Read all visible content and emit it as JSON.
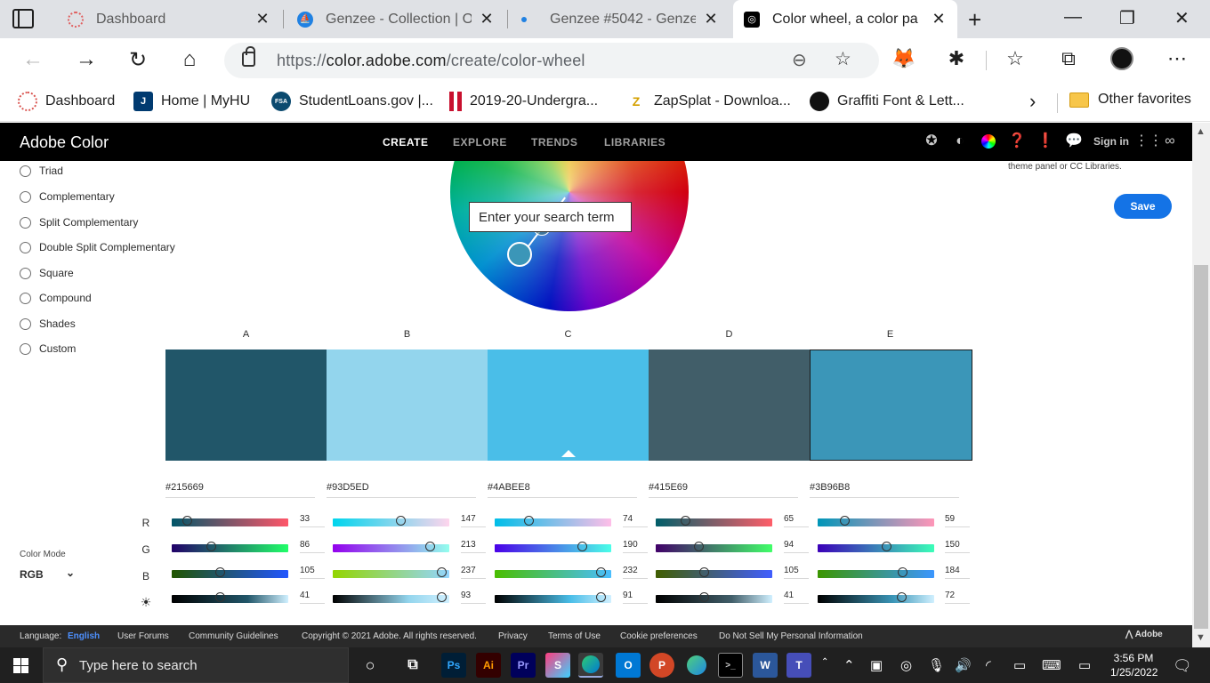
{
  "browser": {
    "tabs": [
      {
        "title": "Dashboard",
        "favicon_color": "#e06060"
      },
      {
        "title": "Genzee - Collection | O",
        "favicon_color": "#2081e2"
      },
      {
        "title": "Genzee #5042 - Genze",
        "favicon_color": "#2081e2"
      },
      {
        "title": "Color wheel, a color pa",
        "favicon_color": "#000000"
      }
    ],
    "close_glyph": "✕",
    "url_prefix": "https://",
    "url_host": "color.adobe.com",
    "url_path": "/create/color-wheel",
    "favorites": [
      {
        "label": "Dashboard",
        "icon_color": "#d9534f",
        "icon_text": ""
      },
      {
        "label": "Home | MyHU",
        "icon_color": "#003a70",
        "icon_text": "J"
      },
      {
        "label": "StudentLoans.gov |...",
        "icon_color": "#0b4a6f",
        "icon_text": "FSA"
      },
      {
        "label": "2019-20-Undergra...",
        "icon_color": "#c8102e",
        "icon_text": ""
      },
      {
        "label": "ZapSplat - Downloa...",
        "icon_color": "#f4c430",
        "icon_text": "Z"
      },
      {
        "label": "Graffiti Font & Lett...",
        "icon_color": "#111111",
        "icon_text": ""
      }
    ],
    "other_favorites": "Other favorites"
  },
  "adobe": {
    "brand": "Adobe Color",
    "nav": [
      "CREATE",
      "EXPLORE",
      "TRENDS",
      "LIBRARIES"
    ],
    "signin": "Sign in",
    "theme_note": "theme panel or CC Libraries.",
    "save": "Save",
    "search_placeholder": "Enter your search term",
    "rules": [
      "Triad",
      "Complementary",
      "Split Complementary",
      "Double Split Complementary",
      "Square",
      "Compound",
      "Shades",
      "Custom"
    ],
    "color_mode_label": "Color Mode",
    "color_mode": "RGB",
    "channel_labels": [
      "R",
      "G",
      "B",
      "☀"
    ],
    "swatches": [
      {
        "label": "A",
        "hex": "#215669",
        "color": "#215669",
        "values": [
          33,
          86,
          105,
          41
        ]
      },
      {
        "label": "B",
        "hex": "#93D5ED",
        "color": "#93D5ED",
        "values": [
          147,
          213,
          237,
          93
        ]
      },
      {
        "label": "C",
        "hex": "#4ABEE8",
        "color": "#4ABEE8",
        "values": [
          74,
          190,
          232,
          91
        ]
      },
      {
        "label": "D",
        "hex": "#415E69",
        "color": "#415E69",
        "values": [
          65,
          94,
          105,
          41
        ]
      },
      {
        "label": "E",
        "hex": "#3B96B8",
        "color": "#3B96B8",
        "values": [
          59,
          150,
          184,
          72
        ]
      }
    ],
    "footer": {
      "language_label": "Language:",
      "language": "English",
      "links": [
        "User Forums",
        "Community Guidelines",
        "Copyright © 2021 Adobe. All rights reserved.",
        "Privacy",
        "Terms of Use",
        "Cookie preferences",
        "Do Not Sell My Personal Information"
      ],
      "adobe": "Adobe"
    }
  },
  "taskbar": {
    "search_placeholder": "Type here to search",
    "time": "3:56 PM",
    "date": "1/25/2022"
  }
}
